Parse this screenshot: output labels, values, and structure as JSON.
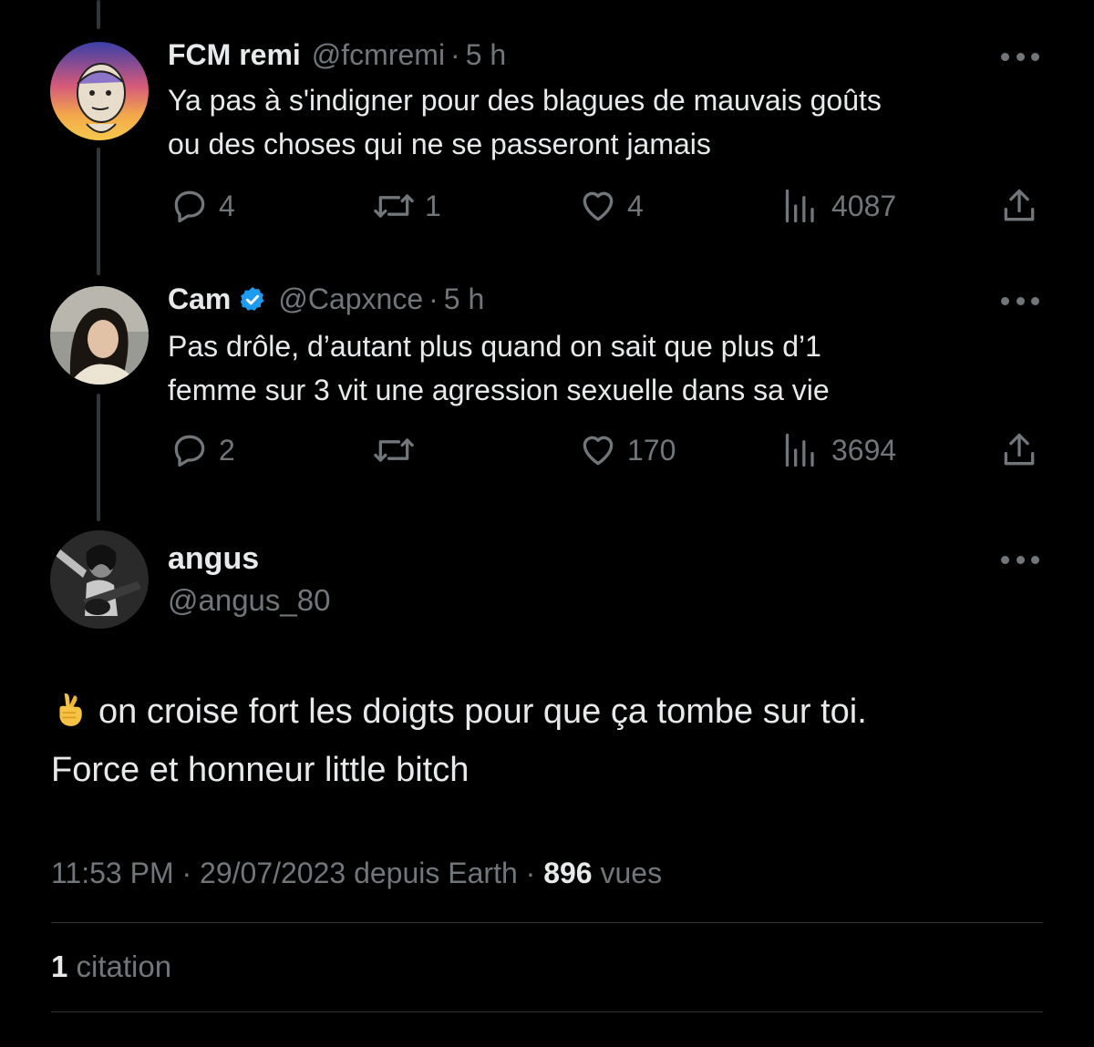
{
  "colors": {
    "background": "#000000",
    "text_primary": "#e7e9ea",
    "text_secondary": "#71767b",
    "verified_blue": "#1d9bf0",
    "divider": "#2f3336"
  },
  "replies": [
    {
      "name": "FCM remi",
      "handle": "@fcmremi",
      "separator": "·",
      "time": "5 h",
      "verified": false,
      "text_lines": [
        "Ya pas à s'indigner pour des blagues de mauvais goûts",
        "ou des choses qui ne se passeront jamais"
      ],
      "reply_count": "4",
      "retweet_count": "1",
      "like_count": "4",
      "view_count": "4087",
      "icons": [
        "reply-icon",
        "retweet-icon",
        "like-icon",
        "views-icon",
        "share-icon",
        "more-icon"
      ]
    },
    {
      "name": "Cam",
      "handle": "@Capxnce",
      "separator": "·",
      "time": "5 h",
      "verified": true,
      "text_lines": [
        "Pas drôle, d’autant plus quand on sait que plus d’1",
        "femme sur 3 vit une agression sexuelle dans sa vie"
      ],
      "reply_count": "2",
      "retweet_count": "",
      "like_count": "170",
      "view_count": "3694",
      "icons": [
        "reply-icon",
        "retweet-icon",
        "like-icon",
        "views-icon",
        "share-icon",
        "more-icon"
      ]
    }
  ],
  "main_tweet": {
    "name": "angus",
    "handle": "@angus_80",
    "emoji_icon": "crossed-fingers-icon",
    "text_line1": "on croise fort les doigts pour que ça tombe sur toi.",
    "text_line2": "Force et honneur little bitch",
    "meta_time": "11:53 PM",
    "meta_separator": "·",
    "meta_date_source": "29/07/2023 depuis Earth",
    "meta_views_number": "896",
    "meta_views_label": "vues",
    "quote_count": "1",
    "quote_label": "citation"
  }
}
